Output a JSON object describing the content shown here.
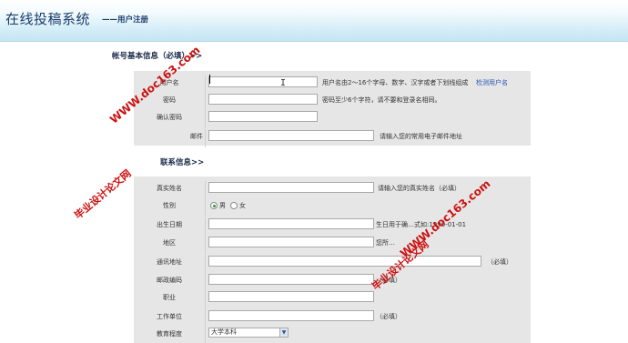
{
  "header": {
    "title": "在线投稿系统",
    "subtitle": "——用户注册"
  },
  "account_section": {
    "title": "帐号基本信息（必填）>>",
    "username": {
      "label": "用户名",
      "value": "",
      "hint": "用户名由2～16个字母、数字、汉字或者下划线组成",
      "check_link": "检测用户名"
    },
    "password": {
      "label": "密码",
      "value": "",
      "hint": "密码至少6个字符，请不要和登录名相同。"
    },
    "confirm_password": {
      "label": "确认密码",
      "value": ""
    },
    "email": {
      "label": "邮件",
      "value": "",
      "hint": "请输入您的常用电子邮件地址"
    }
  },
  "contact_section": {
    "title": "联系信息>>",
    "realname": {
      "label": "真实姓名",
      "value": "",
      "hint": "请输入您的真实姓名（必填）"
    },
    "gender": {
      "label": "性别",
      "options": [
        "男",
        "女"
      ],
      "selected": "男"
    },
    "birthdate": {
      "label": "出生日期",
      "value": "",
      "hint": "生日用于确…式如:1990-01-01"
    },
    "region": {
      "label": "地区",
      "value": "",
      "hint": "您所…"
    },
    "address": {
      "label": "通讯地址",
      "value": "",
      "hint": "（必填）"
    },
    "postcode": {
      "label": "邮政编码",
      "value": "",
      "hint": "（必填）"
    },
    "job": {
      "label": "职业",
      "value": ""
    },
    "company": {
      "label": "工作单位",
      "value": "",
      "hint": "（必填）"
    },
    "education": {
      "label": "教育程度",
      "selected": "大学本科"
    }
  },
  "watermarks": {
    "site": "WWW.doc163.com",
    "brand": "毕业设计论文网"
  },
  "colors": {
    "watermark": "#cc1111",
    "header_text": "#1b3d6a",
    "link": "#2a55b5"
  }
}
